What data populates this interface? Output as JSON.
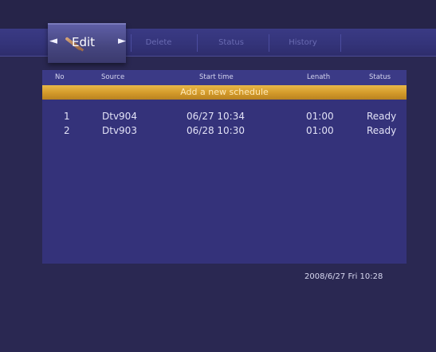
{
  "tabs": {
    "edit": "Edit",
    "delete": "Delete",
    "status": "Status",
    "history": "History"
  },
  "table": {
    "headers": {
      "no": "No",
      "source": "Source",
      "start_time": "Start time",
      "length": "Lenath",
      "status": "Status"
    },
    "add_label": "Add a new schedule",
    "rows": [
      {
        "no": "1",
        "source": "Dtv904",
        "start": "06/27 10:34",
        "length": "01:00",
        "status": "Ready"
      },
      {
        "no": "2",
        "source": "Dtv903",
        "start": "06/28 10:30",
        "length": "01:00",
        "status": "Ready"
      }
    ]
  },
  "clock": "2008/6/27 Fri 10:28",
  "colors": {
    "background": "#2a2852",
    "panel": "#34327a",
    "highlight": "#d39a2a"
  },
  "icons": {
    "edit_tab": "pencil-icon",
    "nav_left": "arrow-left-icon",
    "nav_right": "arrow-right-icon"
  }
}
